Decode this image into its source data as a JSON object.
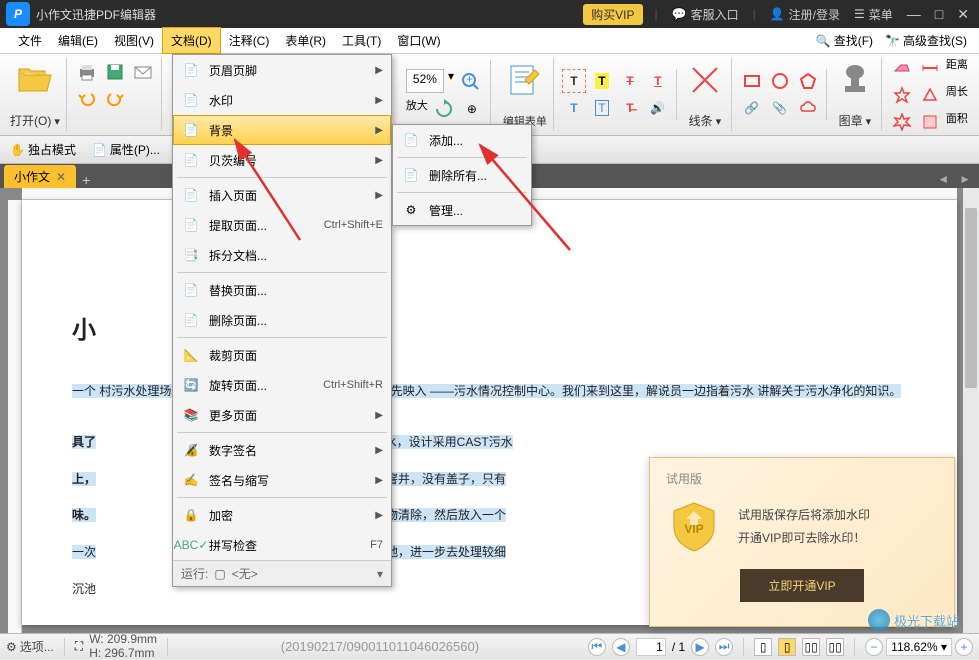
{
  "titlebar": {
    "app_name": "小作文迅捷PDF编辑器",
    "vip": "购买VIP",
    "support": "客服入口",
    "login": "注册/登录",
    "menu": "菜单"
  },
  "menubar": {
    "items": [
      "文件",
      "编辑(E)",
      "视图(V)",
      "文档(D)",
      "注释(C)",
      "表单(R)",
      "工具(T)",
      "窗口(W)"
    ],
    "find": "查找(F)",
    "adv_find": "高级查找(S)"
  },
  "ribbon": {
    "open": "打开(O)",
    "edit_form": "编辑表单",
    "lines": "线条",
    "stamp": "图章",
    "distance": "距离",
    "perimeter": "周长",
    "area": "面积",
    "zoom_pct": "52%"
  },
  "toolbar2": {
    "exclusive": "独占模式",
    "props": "属性(P)..."
  },
  "tab": {
    "name": "小作文"
  },
  "dropdown": {
    "items": [
      {
        "label": "页眉页脚",
        "arrow": true
      },
      {
        "label": "水印",
        "arrow": true
      },
      {
        "label": "背景",
        "arrow": true,
        "hover": true
      },
      {
        "label": "贝茨编号",
        "arrow": true
      },
      {
        "label": "插入页面",
        "arrow": true
      },
      {
        "label": "提取页面...",
        "shortcut": "Ctrl+Shift+E"
      },
      {
        "label": "拆分文档..."
      },
      {
        "label": "替换页面..."
      },
      {
        "label": "删除页面..."
      },
      {
        "label": "裁剪页面"
      },
      {
        "label": "旋转页面...",
        "shortcut": "Ctrl+Shift+R"
      },
      {
        "label": "更多页面",
        "arrow": true
      },
      {
        "label": "数字签名",
        "arrow": true
      },
      {
        "label": "签名与缩写",
        "arrow": true
      },
      {
        "label": "加密",
        "arrow": true
      },
      {
        "label": "拼写检查",
        "shortcut": "F7"
      }
    ],
    "footer_run": "运行:",
    "footer_none": "<无>"
  },
  "submenu": {
    "items": [
      {
        "label": "添加..."
      },
      {
        "label": "删除所有..."
      },
      {
        "label": "管理..."
      }
    ]
  },
  "document": {
    "title_fragment": "小",
    "para1": "一个                                                              村污水处理场。进入大门，一阵阵恶臭扑鼻而来， ，首先映入                                                              ——污水情况控制中心。我们来到这里，解说员一边指着污水                                                              讲解关于污水净化的知识。",
    "para2_a": "具了",
    "para2_b": "%为生活废水，设计采用CAST污水",
    "para2_c": "上，",
    "para2_d": "前面有几个窨井，没有盖子，只有",
    "para2_e": "味。",
    "para2_f": "表面的漂浮物清除，然后放入一个",
    "para2_g": "一次",
    "para2_h": "到曝气沉沙地，进一步去处理较细",
    "para2_i": "沉池"
  },
  "vip_popup": {
    "title": "试用版",
    "line1": "试用版保存后将添加水印",
    "line2": "开通VIP即可去除水印！",
    "cta": "立即开通VIP"
  },
  "statusbar": {
    "options": "选项...",
    "width": "W: 209.9mm",
    "height": "H: 296.7mm",
    "center_text": "(20190217/090011011046026560)",
    "page_current": "1",
    "page_total": "/ 1",
    "zoom": "118.62%"
  },
  "watermark": "极光下载站"
}
